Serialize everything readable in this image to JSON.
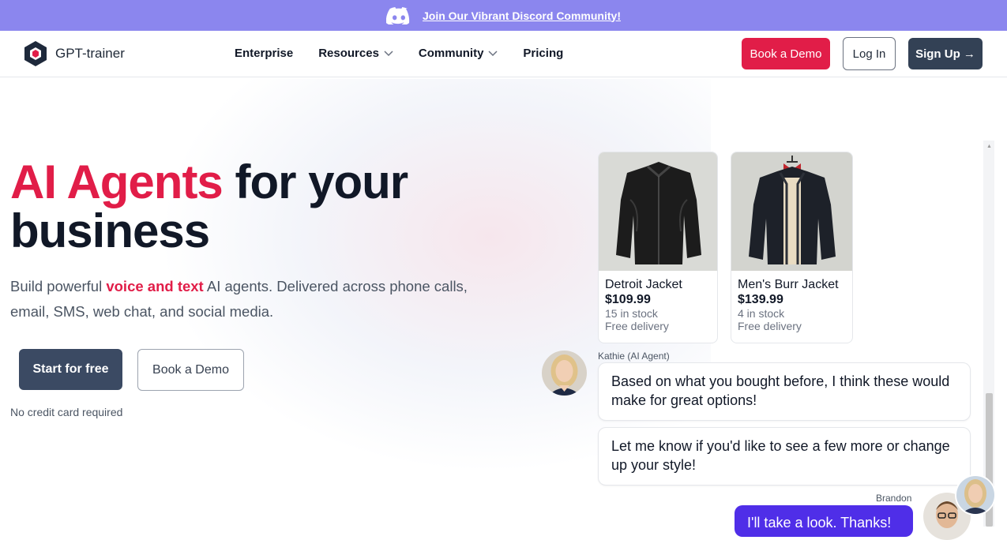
{
  "banner": {
    "text": "Join Our Vibrant Discord Community!",
    "icon": "discord-icon"
  },
  "nav": {
    "brand": "GPT-trainer",
    "menu": [
      {
        "label": "Enterprise"
      },
      {
        "label": "Resources"
      },
      {
        "label": "Community"
      },
      {
        "label": "Pricing"
      }
    ],
    "book_demo": "Book a Demo",
    "login": "Log In",
    "signup": "Sign Up →"
  },
  "hero": {
    "title_accent": "AI Agents",
    "title_rest": " for your business",
    "sub_pre": "Build powerful ",
    "sub_accent": "voice and text",
    "sub_post": " AI agents. Delivered across phone calls, email, SMS, web chat, and social media.",
    "start": "Start for free",
    "book": "Book a Demo",
    "note": "No credit card required"
  },
  "chat": {
    "products": [
      {
        "name": "Detroit Jacket",
        "price": "$109.99",
        "stock": "15 in stock",
        "delivery": "Free delivery"
      },
      {
        "name": "Men's Burr Jacket",
        "price": "$139.99",
        "stock": "4 in stock",
        "delivery": "Free delivery"
      }
    ],
    "agent_name": "Kathie (AI Agent)",
    "messages": [
      "Based on what you bought before, I think these would make for great options!",
      "Let me know if you'd like to see a few more or change up your style!"
    ],
    "user_name": "Brandon",
    "user_message": "I'll take a look. Thanks!"
  },
  "colors": {
    "accent": "#e11d48",
    "banner": "#8b86ee",
    "dark_button": "#334155",
    "user_bubble": "#4f2ee8"
  }
}
